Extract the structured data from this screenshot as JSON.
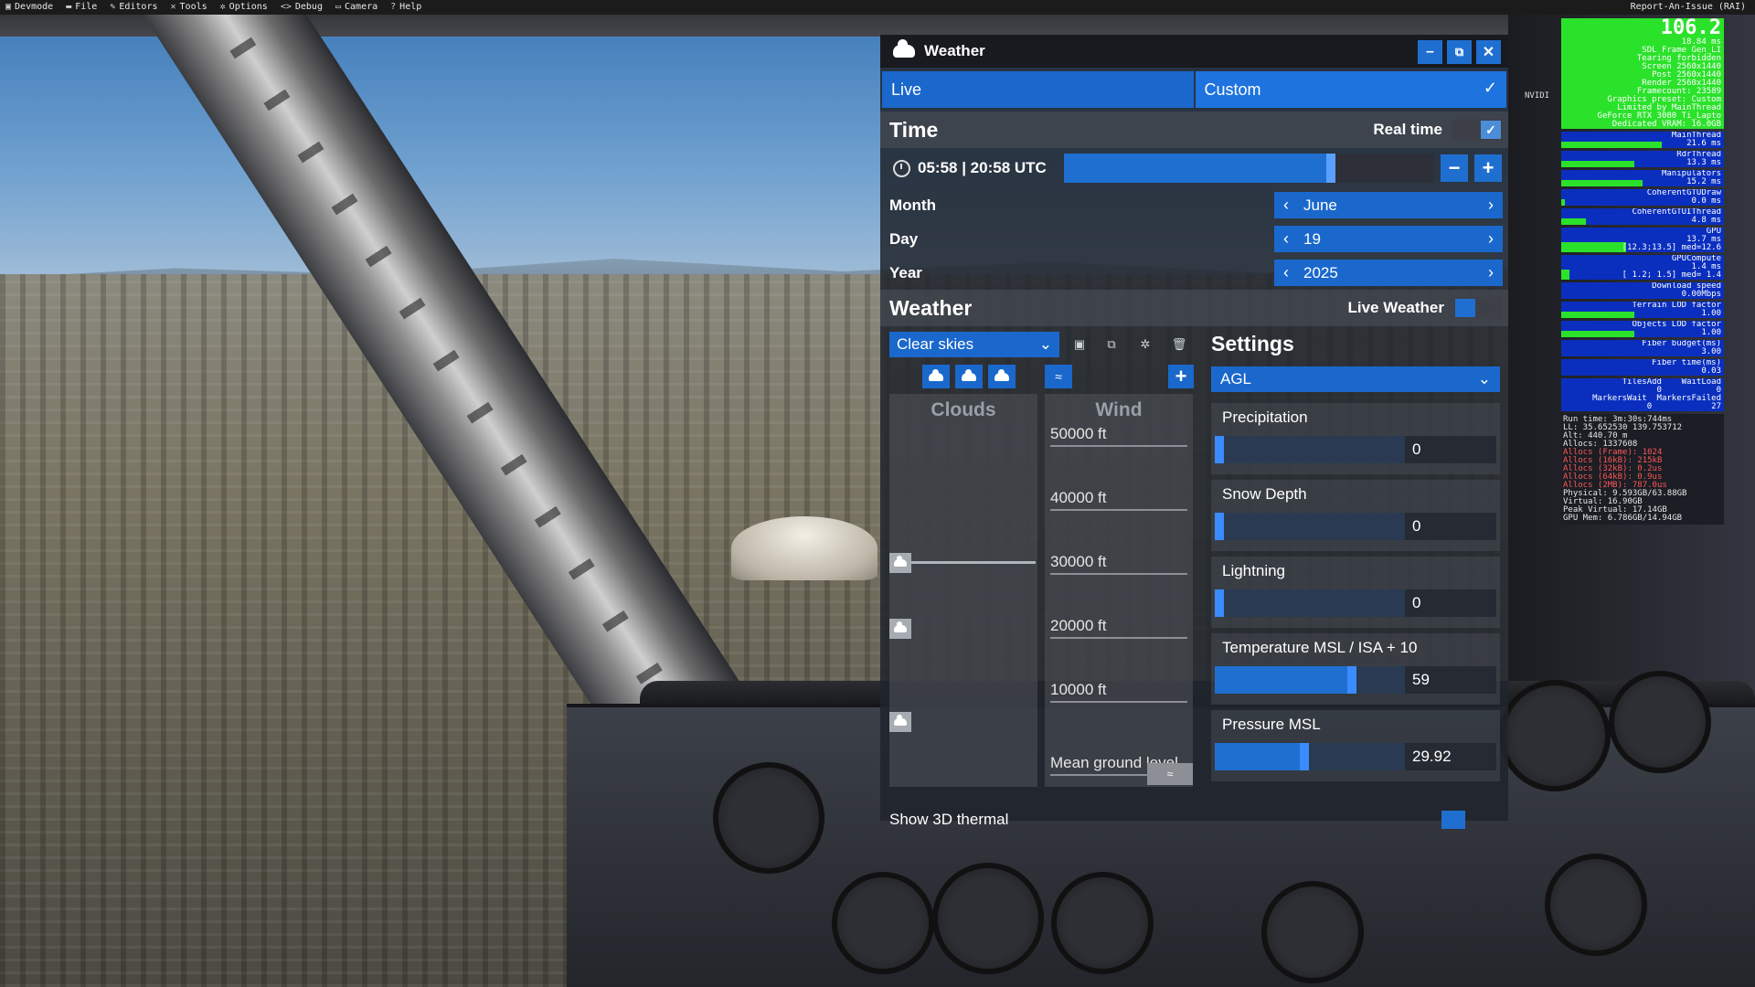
{
  "menubar": {
    "items": [
      {
        "icon": "devmode-icon",
        "label": "Devmode"
      },
      {
        "icon": "folder-icon",
        "label": "File"
      },
      {
        "icon": "pencil-icon",
        "label": "Editors"
      },
      {
        "icon": "tools-icon",
        "label": "Tools"
      },
      {
        "icon": "gear-icon",
        "label": "Options"
      },
      {
        "icon": "code-icon",
        "label": "Debug"
      },
      {
        "icon": "camera-icon",
        "label": "Camera"
      },
      {
        "icon": "help-icon",
        "label": "Help"
      }
    ],
    "report": "Report-An-Issue (RAI)"
  },
  "weather_window": {
    "title": "Weather",
    "tabs": {
      "live": "Live",
      "custom": "Custom"
    },
    "time": {
      "heading": "Time",
      "real_time_label": "Real time",
      "time_text": "05:58 | 20:58 UTC",
      "slider_fraction": 0.72
    },
    "date": {
      "month_label": "Month",
      "month_value": "June",
      "day_label": "Day",
      "day_value": "19",
      "year_label": "Year",
      "year_value": "2025"
    },
    "weather": {
      "heading": "Weather",
      "live_weather_label": "Live Weather",
      "preset": "Clear skies",
      "clouds_header": "Clouds",
      "wind_header": "Wind",
      "altitudes": [
        "50000 ft",
        "40000 ft",
        "30000 ft",
        "20000 ft",
        "10000 ft",
        "Mean ground level"
      ]
    },
    "settings": {
      "heading": "Settings",
      "altitude_ref": "AGL",
      "items": [
        {
          "label": "Precipitation",
          "value": "0",
          "fraction": 0.0
        },
        {
          "label": "Snow Depth",
          "value": "0",
          "fraction": 0.0
        },
        {
          "label": "Lightning",
          "value": "0",
          "fraction": 0.0
        },
        {
          "label": "Temperature MSL / ISA + 10",
          "value": "59",
          "fraction": 0.72
        },
        {
          "label": "Pressure MSL",
          "value": "29.92",
          "fraction": 0.47
        }
      ]
    },
    "show_3d_thermal": "Show 3D thermal"
  },
  "stats": {
    "fps": "106.2",
    "frame_lines": "18.84 ms\nSDL Frame Gen_LI\nTearing forbidden\nScreen 2560x1440\nPost 2560x1440\nRender 2560x1440\nFramecount: 23589\nGraphics preset: Custom",
    "gpu_lines": "Limited by MainThread\nGeForce RTX 3080 Ti_Lapto\nDedicated VRAM: 16.0GB",
    "blocks": [
      {
        "text": "MainThread\n21.6 ms",
        "fraction": 0.62
      },
      {
        "text": "RdrThread\n13.3 ms",
        "fraction": 0.45
      },
      {
        "text": "Manipulators\n15.2 ms",
        "fraction": 0.5
      },
      {
        "text": "CoherentGTUDraw\n0.0 ms",
        "fraction": 0.02
      },
      {
        "text": "CoherentGTUIThread\n4.8 ms",
        "fraction": 0.15
      },
      {
        "text": "GPU\n13.7 ms\n[12.3;13.5] med=12.6",
        "fraction": 0.4
      },
      {
        "text": "GPUCompute\n1.4 ms\n[ 1.2; 1.5] med= 1.4",
        "fraction": 0.05
      },
      {
        "text": "Download speed\n0.00Mbps",
        "fraction": 0.0
      },
      {
        "text": "Terrain LOD factor\n1.00",
        "fraction": 0.45
      },
      {
        "text": "Objects LOD factor\n1.00",
        "fraction": 0.45
      },
      {
        "text": "Fiber budget(ms)\n3.00",
        "fraction": 0.0
      },
      {
        "text": "Fiber time(ms)\n0.03",
        "fraction": 0.0
      },
      {
        "text": "TilesAdd    WaitLoad\n0           0\nMarkersWait  MarkersFailed\n0            27",
        "fraction": 0.0
      }
    ],
    "mem_lines": "Run time: 3m:30s:744ms\nLL: 35.652530 139.753712\nAlt: 440.70 m\nAllocs: 1337608",
    "mem_red": "Allocs (Frame): 1024\nAllocs (16kB): 215kB\nAllocs (32kB): 0.2us\nAllocs (64kB): 0.9us\nAllocs (2MB): 787.0us",
    "mem_tail": "Physical: 9.593GB/63.88GB\nVirtual: 16.90GB\nPeak Virtual: 17.14GB\nGPU Mem: 6.786GB/14.94GB",
    "nvidia_label": "NVIDI"
  },
  "colors": {
    "accent_blue": "#1f6fd1",
    "stats_blue": "#0a2fbf",
    "stats_green": "#2be22b"
  }
}
